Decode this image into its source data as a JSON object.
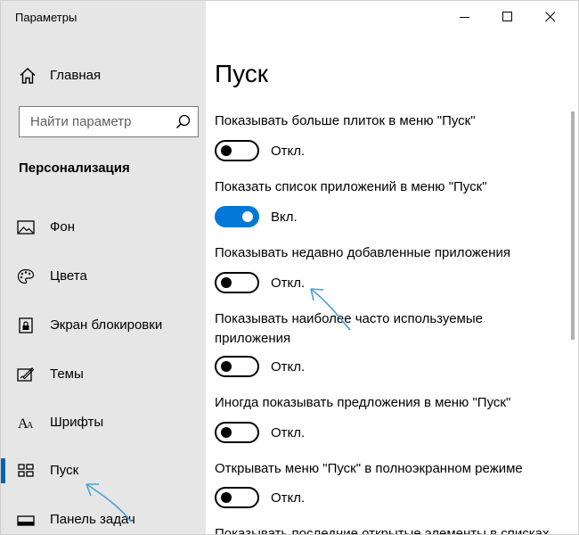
{
  "window": {
    "title": "Параметры",
    "minimize_icon": "minimize-icon",
    "maximize_icon": "maximize-icon",
    "close_icon": "close-icon"
  },
  "sidebar": {
    "home_label": "Главная",
    "search_placeholder": "Найти параметр",
    "section_title": "Персонализация",
    "items": [
      {
        "label": "Фон",
        "icon": "picture-icon"
      },
      {
        "label": "Цвета",
        "icon": "palette-icon"
      },
      {
        "label": "Экран блокировки",
        "icon": "lock-screen-icon"
      },
      {
        "label": "Темы",
        "icon": "themes-icon"
      },
      {
        "label": "Шрифты",
        "icon": "fonts-icon"
      },
      {
        "label": "Пуск",
        "icon": "start-icon",
        "selected": true
      },
      {
        "label": "Панель задач",
        "icon": "taskbar-icon"
      }
    ]
  },
  "main": {
    "title": "Пуск",
    "settings": [
      {
        "label": "Показывать больше плиток в меню \"Пуск\"",
        "state": "Откл.",
        "on": false
      },
      {
        "label": "Показать список приложений в меню \"Пуск\"",
        "state": "Вкл.",
        "on": true
      },
      {
        "label": "Показывать недавно добавленные приложения",
        "state": "Откл.",
        "on": false
      },
      {
        "label": "Показывать наиболее часто используемые приложения",
        "state": "Откл.",
        "on": false
      },
      {
        "label": "Иногда показывать предложения в меню \"Пуск\"",
        "state": "Откл.",
        "on": false
      },
      {
        "label": "Открывать меню \"Пуск\" в полноэкранном режиме",
        "state": "Откл.",
        "on": false
      },
      {
        "label": "Показывать последние открытые элементы в списках",
        "state": "",
        "on": false
      }
    ]
  },
  "colors": {
    "accent": "#0078d7",
    "sidebar_bg": "#e6e6e6",
    "annotation_arrow": "#4a9fd8"
  }
}
